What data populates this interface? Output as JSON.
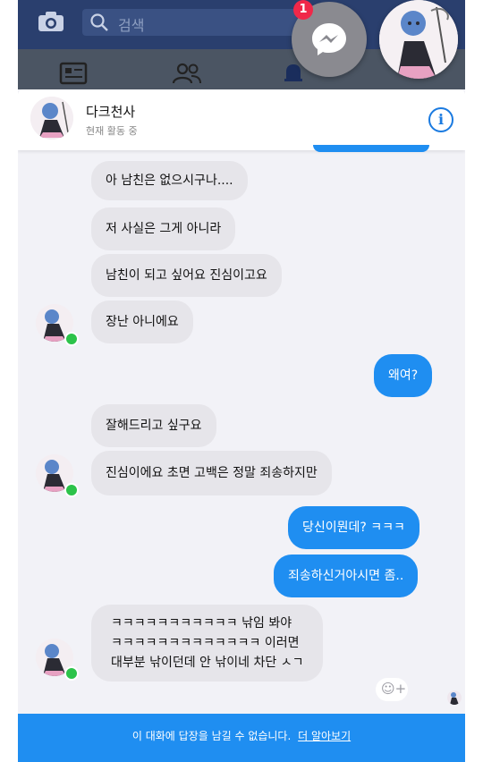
{
  "top_bar": {
    "search_placeholder": "검색",
    "camera_icon": "camera-icon",
    "search_icon": "search-icon"
  },
  "tabs": [
    "news-feed-icon",
    "friends-icon",
    "notifications-icon",
    "menu-icon"
  ],
  "chat_heads": {
    "badge_count": "1",
    "messenger_icon": "messenger-icon"
  },
  "header": {
    "name": "다크천사",
    "status": "현재 활동 중",
    "info_icon": "i"
  },
  "messages": [
    {
      "from": "them",
      "text": "아 남친은 없으시구나...."
    },
    {
      "from": "them",
      "text": "저 사실은 그게 아니라"
    },
    {
      "from": "them",
      "text": "남친이 되고 싶어요 진심이고요"
    },
    {
      "from": "them",
      "text": "장난 아니에요"
    },
    {
      "from": "me",
      "text": "왜여?"
    },
    {
      "from": "them",
      "text": "잘해드리고 싶구요"
    },
    {
      "from": "them",
      "text": "진심이에요 초면 고백은 정말 죄송하지만"
    },
    {
      "from": "me",
      "text": "당신이뭔데? ㅋㅋㅋ"
    },
    {
      "from": "me",
      "text": "죄송하신거아시면 좀.."
    },
    {
      "from": "them",
      "lines": [
        "ㅋㅋㅋㅋㅋㅋㅋㅋㅋㅋㅋ 낚임 봐야",
        "ㅋㅋㅋㅋㅋㅋㅋㅋㅋㅋㅋㅋㅋ 이러면",
        "대부분 낚이던데 안 낚이네 차단 ㅅㄱ"
      ]
    }
  ],
  "emoji_button": "☺+",
  "footer": {
    "text": "이 대화에 답장을 남길 수 없습니다.",
    "link": "더 알아보기"
  }
}
